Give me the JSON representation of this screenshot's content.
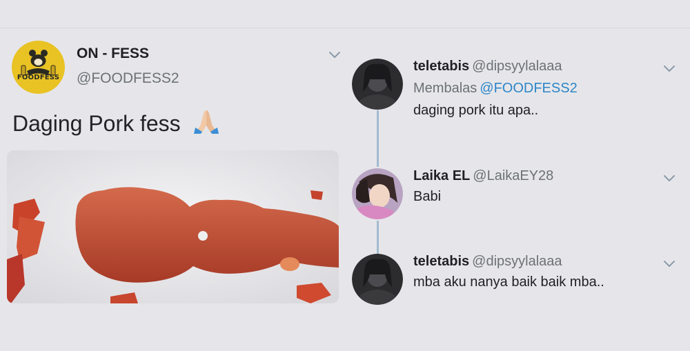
{
  "left_tweet": {
    "avatar_icon": "foodfess-logo",
    "avatar_text": "FOODFESS",
    "name": "ON - FESS",
    "handle": "@FOODFESS2",
    "text": "Daging Pork fess",
    "emoji_icon": "folded-hands-icon",
    "image": "fried-meat-photo"
  },
  "replies": [
    {
      "name": "teletabis",
      "handle": "@dipsyylalaaa",
      "replying_label": "Membalas",
      "replying_to": "@FOODFESS2",
      "text": "daging pork itu apa.."
    },
    {
      "name": "Laika EL",
      "handle": "@LaikaEY28",
      "text": "Babi"
    },
    {
      "name": "teletabis",
      "handle": "@dipsyylalaaa",
      "text": "mba aku nanya baik baik mba.."
    }
  ],
  "colors": {
    "background": "#e6e6ea",
    "link": "#2d86c7",
    "thread_line": "#a4bbd0",
    "avatar_yellow": "#e9c224"
  }
}
